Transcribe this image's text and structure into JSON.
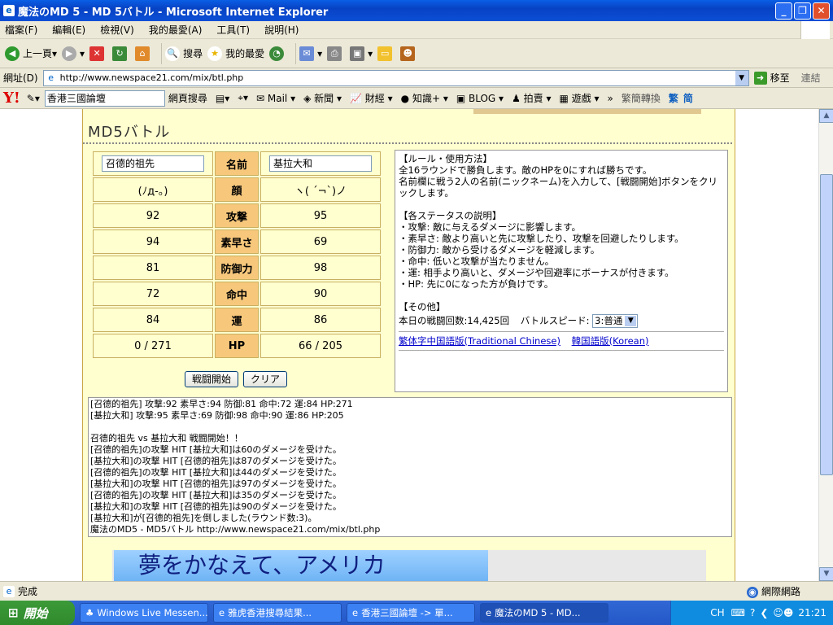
{
  "window": {
    "title": "魔法のMD 5 - MD 5バトル - Microsoft Internet Explorer"
  },
  "menu": [
    "檔案(F)",
    "編輯(E)",
    "檢視(V)",
    "我的最愛(A)",
    "工具(T)",
    "說明(H)"
  ],
  "toolbar": {
    "back": "上一頁",
    "search": "搜尋",
    "favorites": "我的最愛"
  },
  "address": {
    "label": "網址(D)",
    "url": "http://www.newspace21.com/mix/btl.php",
    "go": "移至",
    "links": "連結"
  },
  "yahoo": {
    "search_value": "香港三國論壇",
    "search_btn": "網頁搜尋",
    "mail": "Mail",
    "news": "新聞",
    "finance": "財經",
    "knowledge": "知識+",
    "blog": "BLOG",
    "auction": "拍賣",
    "games": "遊戲",
    "convert": "繁簡轉換",
    "trad": "繁",
    "simp": "简"
  },
  "page": {
    "heading": "MD5バトル",
    "player1": {
      "name": "召德的祖先",
      "face": "(ﾉд-｡)",
      "atk": "92",
      "spd": "94",
      "def": "81",
      "hit": "72",
      "luck": "84",
      "hp": "0 / 271"
    },
    "player2": {
      "name": "基拉大和",
      "face": "ヽ( ´¬`)ノ",
      "atk": "95",
      "spd": "69",
      "def": "98",
      "hit": "90",
      "luck": "86",
      "hp": "66 / 205"
    },
    "labels": {
      "name": "名前",
      "face": "顔",
      "atk": "攻撃",
      "spd": "素早さ",
      "def": "防御力",
      "hit": "命中",
      "luck": "運",
      "hp": "HP"
    },
    "start_btn": "戦闘開始",
    "clear_btn": "クリア",
    "rules": {
      "title": "【ルール・使用方法】",
      "l1": "全16ラウンドで勝負します。敵のHPを0にすれば勝ちです。",
      "l2": "名前欄に戦う2人の名前(ニックネーム)を入力して、[戦闘開始]ボタンをクリックします。",
      "status_title": "【各ステータスの説明】",
      "s1": "・攻撃: 敵に与えるダメージに影響します。",
      "s2": "・素早さ: 敵より高いと先に攻撃したり、攻撃を回避したりします。",
      "s3": "・防御力: 敵から受けるダメージを軽減します。",
      "s4": "・命中: 低いと攻撃が当たりません。",
      "s5": "・運: 相手より高いと、ダメージや回避率にボーナスが付きます。",
      "s6": "・HP: 先に0になった方が負けです。",
      "other_title": "【その他】",
      "count": "本日の戦闘回数:14,425回",
      "speed_label": "バトルスピード:",
      "speed_value": "3:普通",
      "link_tc": "繁体字中国語版(Traditional Chinese)",
      "link_kr": "韓国語版(Korean)"
    },
    "log": [
      "[召德的祖先] 攻撃:92 素早さ:94 防御:81 命中:72 運:84 HP:271",
      "[基拉大和] 攻撃:95 素早さ:69 防御:98 命中:90 運:86 HP:205",
      "",
      "召德的祖先 vs 基拉大和 戦闘開始！！",
      "[召德的祖先]の攻撃 HIT [基拉大和]は60のダメージを受けた。",
      "[基拉大和]の攻撃 HIT [召德的祖先]は87のダメージを受けた。",
      "[召德的祖先]の攻撃 HIT [基拉大和]は44のダメージを受けた。",
      "[基拉大和]の攻撃 HIT [召德的祖先]は97のダメージを受けた。",
      "[召德的祖先]の攻撃 HIT [基拉大和]は35のダメージを受けた。",
      "[基拉大和]の攻撃 HIT [召德的祖先]は90のダメージを受けた。",
      "[基拉大和]が[召德的祖先]を倒しました(ラウンド数:3)。",
      "魔法のMD5 - MD5バトル http://www.newspace21.com/mix/btl.php"
    ],
    "banner": "夢をかなえて、アメリカ"
  },
  "status": {
    "text": "完成",
    "zone": "網際網路"
  },
  "taskbar": {
    "start": "開始",
    "tasks": [
      "Windows Live Messen...",
      "雅虎香港搜尋結果...",
      "香港三國論壇 -> 單...",
      "魔法のMD 5 - MD..."
    ],
    "lang": "CH",
    "clock": "21:21"
  }
}
